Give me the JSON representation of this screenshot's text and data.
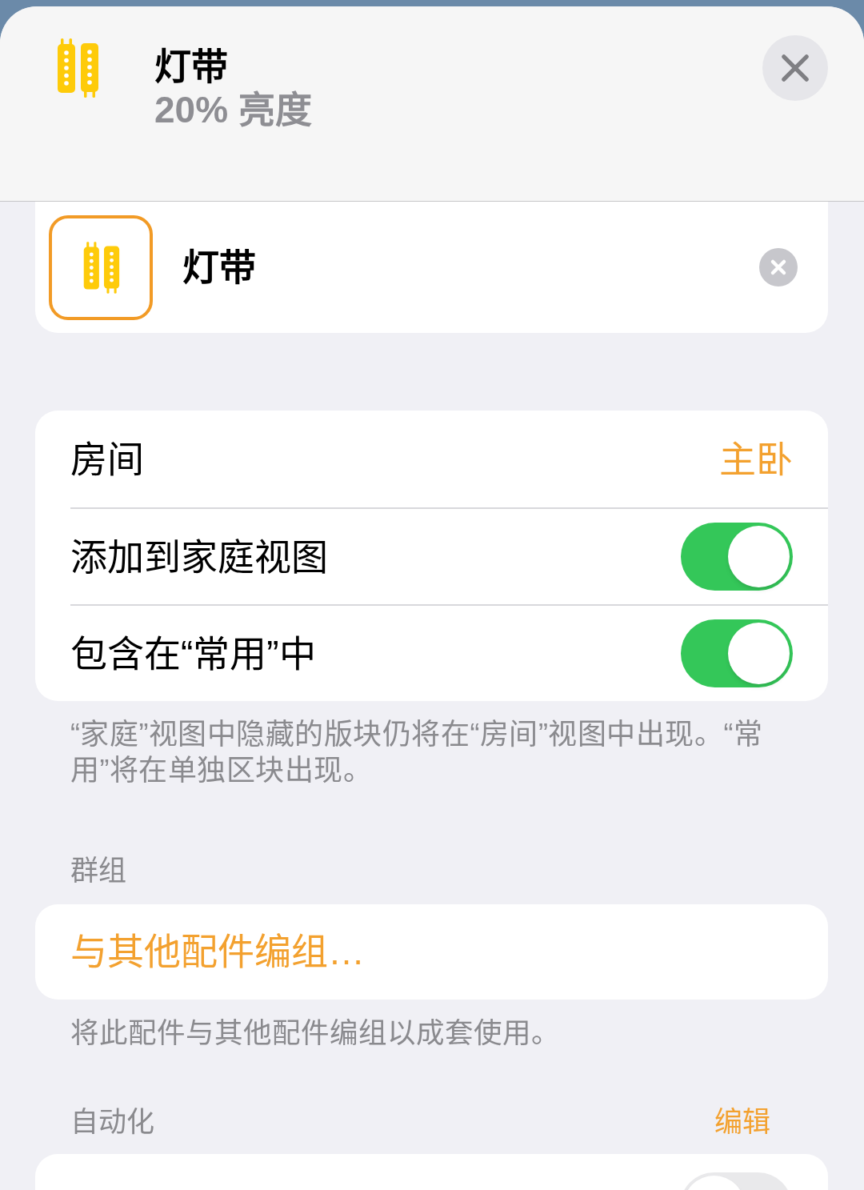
{
  "header": {
    "title": "灯带",
    "subtitle": "20% 亮度"
  },
  "name_field": {
    "value": "灯带"
  },
  "settings": [
    {
      "kind": "value",
      "label": "房间",
      "value": "主卧"
    },
    {
      "kind": "toggle",
      "label": "添加到家庭视图",
      "on": true
    },
    {
      "kind": "toggle",
      "label": "包含在“常用”中",
      "on": true
    }
  ],
  "settings_footer": "“家庭”视图中隐藏的版块仍将在“房间”视图中出现。“常用”将在单独区块出现。",
  "groups": {
    "header": "群组",
    "action": "与其他配件编组…",
    "footer": "将此配件与其他配件编组以成套使用。"
  },
  "automation": {
    "header": "自动化",
    "edit": "编辑",
    "rows": [
      {
        "kind": "toggle",
        "on": false
      }
    ]
  }
}
